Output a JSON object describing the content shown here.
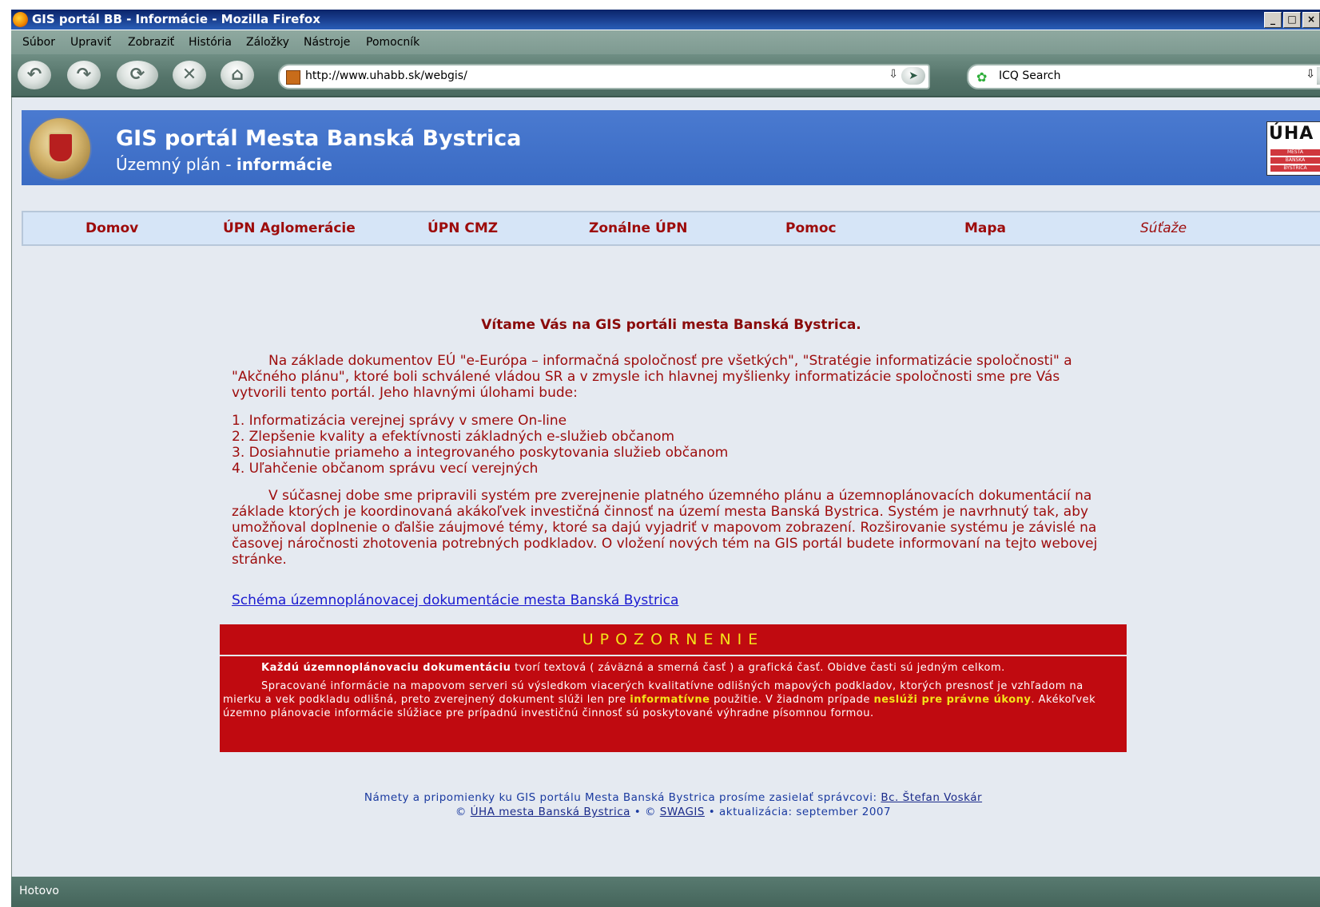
{
  "window": {
    "title": "GIS portál BB - Informácie - Mozilla Firefox",
    "buttons": [
      "_",
      "□",
      "×"
    ]
  },
  "menu": {
    "items": [
      "Súbor",
      "Upraviť",
      "Zobraziť",
      "História",
      "Záložky",
      "Nástroje",
      "Pomocník"
    ]
  },
  "toolbar": {
    "url": "http://www.uhabb.sk/webgis/",
    "search_value": "ICQ Search"
  },
  "banner": {
    "title": "GIS portál Mesta Banská Bystrica",
    "subtitle_plain": "Územný plán - ",
    "subtitle_bold": "informácie",
    "logo_text": "ÚHA",
    "logo_lines": [
      "MESTA",
      "BANSKÁ",
      "BYSTRICA"
    ]
  },
  "nav": {
    "items": [
      "Domov",
      "ÚPN Aglomerácie",
      "ÚPN CMZ",
      "Zonálne ÚPN",
      "Pomoc",
      "Mapa",
      "Súťaže"
    ]
  },
  "content": {
    "welcome": "Vítame Vás na GIS portáli mesta Banská Bystrica.",
    "para1": "Na základe dokumentov EÚ \"e-Európa – informačná spoločnosť pre všetkých\", \"Stratégie informatizácie spoločnosti\" a \"Akčného plánu\", ktoré boli schválené vládou SR a v zmysle ich hlavnej myšlienky informatizácie spoločnosti sme pre Vás vytvorili tento portál. Jeho hlavnými úlohami bude:",
    "list": [
      "1. Informatizácia verejnej správy v smere On-line",
      "2. Zlepšenie kvality a efektívnosti základných e-služieb občanom",
      "3. Dosiahnutie priameho a integrovaného poskytovania služieb občanom",
      "4. Uľahčenie občanom správu vecí verejných"
    ],
    "para2": "V súčasnej dobe sme pripravili systém pre zverejnenie platného územného plánu a územnoplánovacích dokumentácií na základe ktorých je koordinovaná akákoľvek investičná činnosť na území mesta Banská Bystrica. Systém je navrhnutý tak, aby umožňoval doplnenie o ďalšie záujmové témy, ktoré sa dajú vyjadriť v mapovom zobrazení. Rozširovanie systému je závislé na časovej náročnosti zhotovenia potrebných podkladov. O vložení nových tém na GIS portál budete informovaní na tejto webovej stránke.",
    "schema_link": "Schéma územnoplánovacej dokumentácie mesta Banská Bystrica"
  },
  "warning": {
    "heading": "UPOZORNENIE",
    "p1_bold": "Každú územnoplánovaciu dokumentáciu",
    "p1_rest": " tvorí textová ( záväzná a smerná časť ) a grafická časť. Obidve časti sú jedným celkom.",
    "p2_a": "Spracované informácie na mapovom serveri sú výsledkom viacerých kvalitatívne odlišných mapových podkladov, ktorých presnosť je vzhľadom na mierku a vek podkladu odlišná, preto zverejnený dokument slúži len pre ",
    "p2_b": "informatívne",
    "p2_c": " použitie. V žiadnom prípade ",
    "p2_d": "neslúži pre právne úkony",
    "p2_e": ". Akékoľvek územno plánovacie informácie slúžiace pre prípadnú investičnú činnosť sú poskytované výhradne písomnou formou."
  },
  "footer": {
    "line1_text": "Námety a pripomienky ku GIS portálu Mesta Banská Bystrica prosíme zasielať správcovi: ",
    "line1_link": "Bc. Štefan Voskár",
    "copy1": "© ",
    "link2": "ÚHA mesta Banská Bystrica",
    "sep": " • © ",
    "link3": "SWAGIS",
    "tail": " • aktualizácia: september 2007"
  },
  "status": {
    "text": "Hotovo"
  },
  "colors": {
    "banner": "#3a6bc4",
    "nav_text": "#9d0b0b",
    "warning_bg": "#c00a10",
    "warning_heading": "#f4e41a"
  }
}
